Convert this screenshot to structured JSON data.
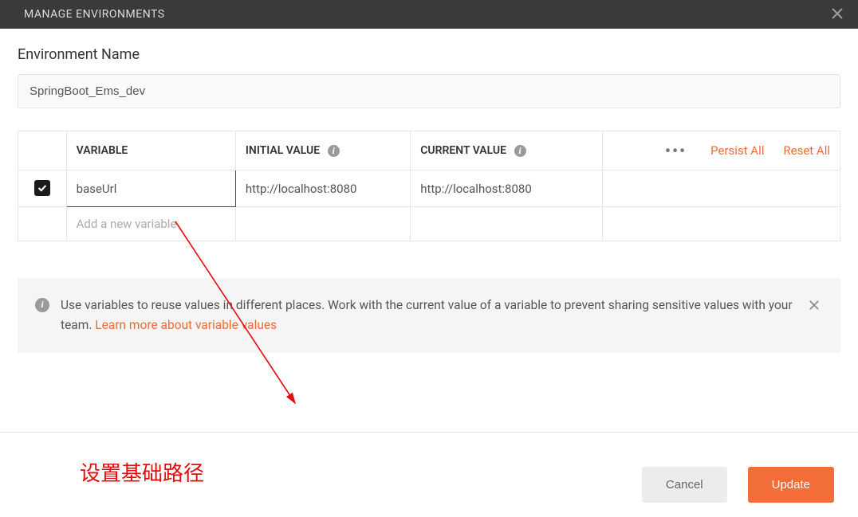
{
  "titlebar": {
    "title": "MANAGE ENVIRONMENTS"
  },
  "envName": {
    "label": "Environment Name",
    "value": "SpringBoot_Ems_dev"
  },
  "columns": {
    "variable": "VARIABLE",
    "initial": "INITIAL VALUE",
    "current": "CURRENT VALUE"
  },
  "rows": [
    {
      "checked": true,
      "variable": "baseUrl",
      "initial": "http://localhost:8080",
      "current": "http://localhost:8080"
    }
  ],
  "newRow": {
    "placeholder": "Add a new variable"
  },
  "actions": {
    "persistAll": "Persist All",
    "resetAll": "Reset All"
  },
  "infoBanner": {
    "text": "Use variables to reuse values in different places. Work with the current value of a variable to prevent sharing sensitive values with your team. ",
    "linkText": "Learn more about variable values"
  },
  "footer": {
    "cancel": "Cancel",
    "update": "Update"
  },
  "annotation": {
    "text": "设置基础路径"
  },
  "colors": {
    "accent": "#f26d38",
    "annotation": "#e40c0c"
  }
}
